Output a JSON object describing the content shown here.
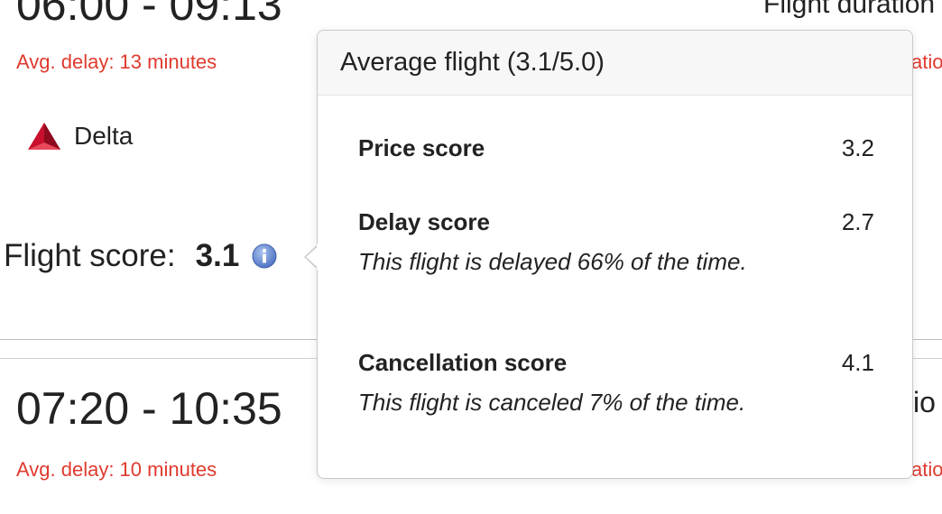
{
  "flights": [
    {
      "time_range": "06:00 - 09:13",
      "avg_delay": "Avg. delay: 13 minutes",
      "airline": "Delta",
      "flight_duration_label": "Flight duration",
      "score_label": "Flight score:",
      "score_value": "3.1"
    },
    {
      "time_range": "07:20 - 10:35",
      "avg_delay": "Avg. delay: 10 minutes"
    }
  ],
  "popover": {
    "title": "Average flight (3.1/5.0)",
    "scores": [
      {
        "name": "Price score",
        "value": "3.2",
        "description": ""
      },
      {
        "name": "Delay score",
        "value": "2.7",
        "description": "This flight is delayed 66% of the time."
      },
      {
        "name": "Cancellation score",
        "value": "4.1",
        "description": "This flight is canceled 7% of the time."
      }
    ]
  },
  "icons": {
    "airline_logo": "delta-logo-icon",
    "info": "info-icon"
  },
  "colors": {
    "delay_text": "#e03a2f",
    "info_icon": "#5b7fc7",
    "delta_red": "#c8102e"
  }
}
